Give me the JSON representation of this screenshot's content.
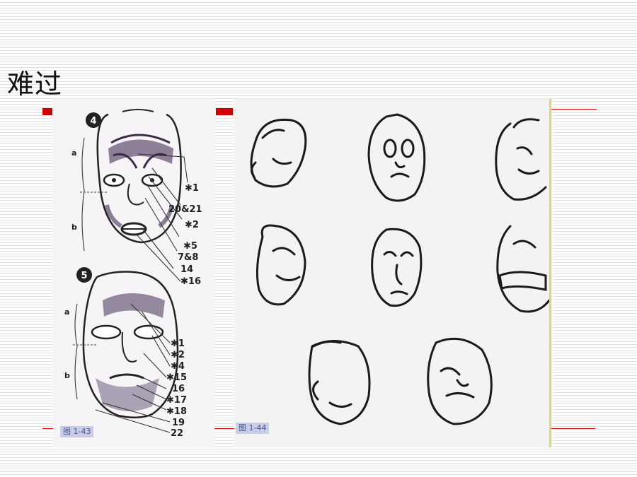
{
  "slide": {
    "title": "难过"
  },
  "figure_left": {
    "caption": "图 1-43",
    "face_a": {
      "number": "4",
      "section_labels": [
        "a",
        "b"
      ],
      "labels": [
        "✱1",
        "20&21",
        "✱2",
        "✱5",
        "7&8",
        "14",
        "✱16"
      ]
    },
    "face_b": {
      "number": "5",
      "section_labels": [
        "a",
        "b"
      ],
      "labels": [
        "✱1",
        "✱2",
        "✱4",
        "✱15",
        "16",
        "✱17",
        "✱18",
        "19",
        "22"
      ]
    }
  },
  "figure_right": {
    "caption": "图 1-44"
  },
  "colors": {
    "accent_red": "#d00000",
    "caption_bg": "#c9cde8"
  }
}
